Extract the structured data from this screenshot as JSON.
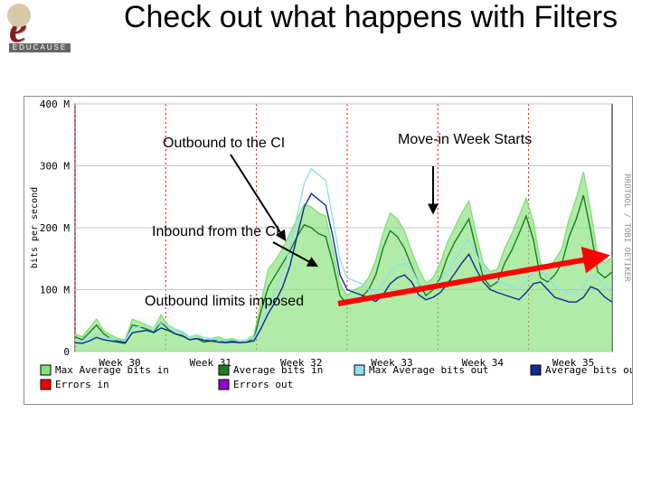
{
  "title": "Check out what happens with Filters",
  "logo": {
    "brand": "EDUCAUSE",
    "glyph": "e"
  },
  "annotations": {
    "outbound_ci": "Outbound to the CI",
    "inbound_ci": "Inbound from the CI",
    "movein": "Move-in\nWeek Starts",
    "limits": "Outbound limits imposed"
  },
  "legend": {
    "max_in": "Max Average bits in",
    "avg_in": "Average bits in",
    "max_out": "Max Average bits out",
    "avg_out": "Average bits out",
    "err_in": "Errors in",
    "err_out": "Errors out"
  },
  "ylabel": "bits per second",
  "rrd": "RRDTOOL / TOBI OETIKER",
  "chart_data": {
    "type": "line",
    "title": "",
    "xlabel": "",
    "ylabel": "bits per second",
    "ylim": [
      0,
      420000000
    ],
    "categories": [
      "Week 30",
      "Week 31",
      "Week 32",
      "Week 33",
      "Week 34",
      "Week 35"
    ],
    "y_ticks": [
      "0",
      "100 M",
      "200 M",
      "300 M",
      "400 M"
    ],
    "series": [
      {
        "name": "Max Average bits in",
        "color": "#86e07a",
        "values": [
          30,
          25,
          40,
          55,
          35,
          28,
          22,
          20,
          55,
          50,
          45,
          40,
          62,
          45,
          38,
          32,
          25,
          28,
          20,
          22,
          25,
          20,
          22,
          18,
          20,
          28,
          85,
          140,
          155,
          175,
          200,
          225,
          250,
          245,
          235,
          230,
          175,
          115,
          95,
          105,
          110,
          125,
          155,
          200,
          235,
          225,
          205,
          170,
          140,
          115,
          125,
          150,
          185,
          210,
          235,
          255,
          200,
          150,
          135,
          140,
          175,
          200,
          230,
          260,
          220,
          150,
          140,
          155,
          175,
          225,
          260,
          305,
          240,
          160,
          150,
          160
        ]
      },
      {
        "name": "Average bits in",
        "color": "#1e7d20",
        "values": [
          25,
          20,
          32,
          45,
          30,
          22,
          18,
          16,
          45,
          42,
          38,
          33,
          50,
          38,
          30,
          26,
          20,
          22,
          16,
          18,
          20,
          16,
          18,
          15,
          16,
          22,
          70,
          110,
          130,
          150,
          170,
          195,
          215,
          210,
          200,
          195,
          150,
          95,
          80,
          88,
          92,
          105,
          130,
          175,
          205,
          195,
          175,
          145,
          115,
          95,
          105,
          125,
          160,
          185,
          205,
          225,
          175,
          125,
          110,
          118,
          150,
          172,
          200,
          230,
          190,
          125,
          118,
          130,
          150,
          195,
          225,
          265,
          205,
          135,
          125,
          135
        ]
      },
      {
        "name": "Max Average bits out",
        "color": "#8fe0f2",
        "values": [
          20,
          18,
          22,
          30,
          25,
          22,
          20,
          18,
          40,
          42,
          45,
          40,
          50,
          45,
          38,
          34,
          25,
          28,
          24,
          22,
          20,
          18,
          20,
          18,
          20,
          22,
          50,
          80,
          105,
          135,
          175,
          230,
          285,
          310,
          300,
          290,
          225,
          155,
          125,
          120,
          115,
          105,
          100,
          115,
          135,
          145,
          150,
          140,
          115,
          105,
          110,
          120,
          135,
          155,
          175,
          190,
          165,
          140,
          125,
          120,
          115,
          110,
          105,
          120,
          135,
          140,
          125,
          110,
          105,
          100,
          100,
          110,
          130,
          125,
          110,
          100
        ]
      },
      {
        "name": "Average bits out",
        "color": "#122a9b",
        "values": [
          15,
          14,
          18,
          24,
          20,
          18,
          16,
          14,
          32,
          34,
          36,
          32,
          40,
          36,
          30,
          27,
          20,
          22,
          19,
          18,
          16,
          15,
          16,
          15,
          16,
          18,
          40,
          65,
          85,
          110,
          145,
          195,
          245,
          268,
          258,
          248,
          195,
          130,
          105,
          100,
          96,
          90,
          85,
          96,
          115,
          125,
          130,
          118,
          96,
          88,
          92,
          100,
          115,
          132,
          150,
          165,
          140,
          118,
          105,
          100,
          96,
          92,
          88,
          100,
          115,
          118,
          105,
          92,
          88,
          84,
          84,
          92,
          110,
          105,
          92,
          84
        ]
      }
    ]
  }
}
